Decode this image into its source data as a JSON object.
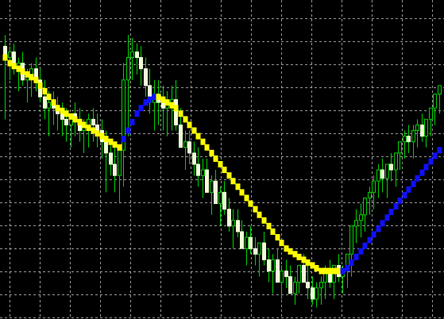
{
  "chart_data": {
    "type": "candlestick",
    "title": "",
    "xlabel": "",
    "ylabel": "",
    "ylim": [
      0,
      100
    ],
    "grid": true,
    "legend": "none",
    "colors": {
      "background": "#000000",
      "grid": "#c8c8c8",
      "bull_wick": "#00d000",
      "bull_body": "#000000",
      "bear_wick": "#00d000",
      "bear_body": "#f0ffd8",
      "indicator_up": "#1010ff",
      "indicator_down": "#ffff00"
    },
    "series": [
      {
        "kind": "candles",
        "o": [
          92,
          88,
          90,
          84,
          86,
          80,
          82,
          84,
          80,
          74,
          70,
          72,
          70,
          68,
          66,
          64,
          68,
          66,
          62,
          64,
          66,
          64,
          62,
          58,
          54,
          50,
          46,
          55,
          80,
          88,
          90,
          88,
          84,
          78,
          72,
          74,
          72,
          70,
          72,
          73,
          64,
          56,
          58,
          54,
          50,
          46,
          48,
          40,
          44,
          36,
          40,
          34,
          28,
          30,
          26,
          20,
          24,
          20,
          18,
          22,
          16,
          12,
          16,
          8,
          12,
          10,
          4,
          8,
          14,
          8,
          6,
          2,
          6,
          8,
          12,
          8,
          14,
          10,
          12,
          18,
          28,
          30,
          32,
          38,
          40,
          44,
          48,
          45,
          50,
          48,
          54,
          58,
          60,
          58,
          62,
          64,
          60,
          66,
          70,
          75
        ],
        "h": [
          96,
          92,
          93,
          88,
          90,
          84,
          86,
          88,
          84,
          80,
          76,
          76,
          74,
          72,
          70,
          68,
          72,
          70,
          66,
          68,
          70,
          68,
          66,
          62,
          58,
          56,
          50,
          86,
          96,
          95,
          93,
          92,
          88,
          84,
          80,
          80,
          78,
          76,
          78,
          80,
          70,
          62,
          62,
          58,
          56,
          52,
          52,
          46,
          48,
          42,
          44,
          38,
          34,
          34,
          30,
          26,
          28,
          24,
          22,
          26,
          20,
          18,
          20,
          14,
          16,
          14,
          10,
          14,
          18,
          14,
          10,
          8,
          10,
          14,
          16,
          14,
          18,
          14,
          18,
          26,
          34,
          36,
          38,
          42,
          46,
          50,
          52,
          50,
          54,
          54,
          58,
          62,
          64,
          64,
          66,
          68,
          66,
          70,
          74,
          78
        ],
        "l": [
          66,
          80,
          82,
          76,
          78,
          72,
          74,
          76,
          72,
          66,
          60,
          64,
          62,
          60,
          58,
          56,
          60,
          58,
          54,
          56,
          58,
          56,
          52,
          40,
          46,
          40,
          36,
          42,
          60,
          80,
          82,
          78,
          74,
          68,
          62,
          64,
          62,
          60,
          62,
          62,
          56,
          48,
          50,
          46,
          42,
          38,
          40,
          32,
          36,
          28,
          32,
          26,
          20,
          24,
          20,
          14,
          18,
          14,
          10,
          14,
          8,
          4,
          10,
          2,
          6,
          4,
          0,
          4,
          8,
          2,
          0,
          -1,
          0,
          2,
          6,
          2,
          8,
          4,
          6,
          10,
          22,
          24,
          26,
          32,
          34,
          38,
          40,
          38,
          44,
          42,
          48,
          52,
          54,
          52,
          56,
          58,
          56,
          60,
          64,
          68
        ],
        "c": [
          88,
          90,
          84,
          86,
          80,
          82,
          84,
          80,
          74,
          70,
          72,
          70,
          68,
          66,
          64,
          68,
          66,
          62,
          64,
          66,
          64,
          62,
          58,
          54,
          50,
          46,
          55,
          80,
          88,
          90,
          88,
          84,
          78,
          72,
          74,
          72,
          70,
          72,
          73,
          64,
          56,
          58,
          54,
          50,
          46,
          48,
          40,
          44,
          36,
          40,
          34,
          28,
          30,
          26,
          20,
          24,
          20,
          18,
          22,
          16,
          12,
          16,
          8,
          12,
          10,
          4,
          8,
          14,
          8,
          6,
          2,
          6,
          8,
          12,
          8,
          14,
          10,
          12,
          18,
          28,
          30,
          32,
          38,
          40,
          44,
          48,
          45,
          50,
          48,
          54,
          58,
          60,
          58,
          62,
          64,
          60,
          66,
          70,
          75,
          78
        ]
      },
      {
        "kind": "indicator",
        "values": [
          88,
          86,
          85,
          84,
          83,
          82,
          81,
          80,
          78,
          76,
          74,
          72,
          70,
          69,
          68,
          67,
          66,
          65,
          64,
          63,
          62,
          61,
          60,
          59,
          58,
          57,
          56,
          59,
          62,
          65,
          68,
          70,
          72,
          73,
          74,
          74,
          73,
          72,
          71,
          70,
          68,
          66,
          64,
          62,
          60,
          58,
          56,
          54,
          52,
          50,
          48,
          46,
          44,
          42,
          40,
          38,
          36,
          34,
          32,
          30,
          28,
          26,
          24,
          22,
          20,
          19,
          18,
          17,
          16,
          15,
          14,
          13,
          12,
          12,
          12,
          12,
          12,
          12,
          13,
          15,
          17,
          19,
          21,
          23,
          25,
          27,
          29,
          31,
          33,
          35,
          37,
          39,
          41,
          43,
          45,
          47,
          49,
          51,
          53,
          55
        ],
        "direction": [
          "down",
          "down",
          "down",
          "down",
          "down",
          "down",
          "down",
          "down",
          "down",
          "down",
          "down",
          "down",
          "down",
          "down",
          "down",
          "down",
          "down",
          "down",
          "down",
          "down",
          "down",
          "down",
          "down",
          "down",
          "down",
          "down",
          "down",
          "up",
          "up",
          "up",
          "up",
          "up",
          "up",
          "up",
          "up",
          "down",
          "down",
          "down",
          "down",
          "down",
          "down",
          "down",
          "down",
          "down",
          "down",
          "down",
          "down",
          "down",
          "down",
          "down",
          "down",
          "down",
          "down",
          "down",
          "down",
          "down",
          "down",
          "down",
          "down",
          "down",
          "down",
          "down",
          "down",
          "down",
          "down",
          "down",
          "down",
          "down",
          "down",
          "down",
          "down",
          "down",
          "down",
          "down",
          "down",
          "down",
          "down",
          "up",
          "up",
          "up",
          "up",
          "up",
          "up",
          "up",
          "up",
          "up",
          "up",
          "up",
          "up",
          "up",
          "up",
          "up",
          "up",
          "up",
          "up",
          "up",
          "up",
          "up",
          "up",
          "up"
        ]
      }
    ]
  }
}
